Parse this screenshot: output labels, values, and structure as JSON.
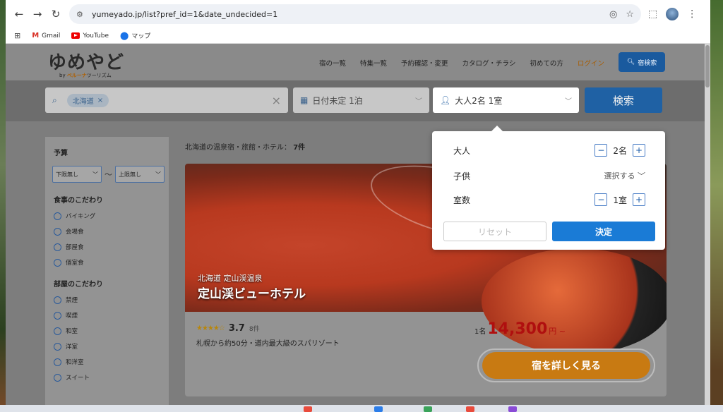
{
  "browser": {
    "url": "yumeyado.jp/list?pref_id=1&date_undecided=1",
    "bookmarks": [
      {
        "label": "Gmail"
      },
      {
        "label": "YouTube"
      },
      {
        "label": "マップ"
      }
    ]
  },
  "header": {
    "logo": "ゆめやど",
    "logo_sub_by": "by ",
    "logo_sub_brand": "ベルーナ",
    "logo_sub_rest": "ツーリズム",
    "nav": [
      "宿の一覧",
      "特集一覧",
      "予約確認・変更",
      "カタログ・チラシ",
      "初めての方",
      "ログイン"
    ],
    "search_button": "宿検索"
  },
  "search": {
    "area_chip": "北海道",
    "date_label": "日付未定 1泊",
    "guests_label": "大人2名 1室",
    "search_button": "検索"
  },
  "sidebar": {
    "budget_title": "予算",
    "budget_min": "下限無し",
    "budget_sep": "〜",
    "budget_max": "上限無し",
    "meal_title": "食事のこだわり",
    "meal_options": [
      "バイキング",
      "会場食",
      "部屋食",
      "個室食"
    ],
    "room_title": "部屋のこだわり",
    "room_options": [
      "禁煙",
      "喫煙",
      "和室",
      "洋室",
      "和洋室",
      "スイート"
    ]
  },
  "results": {
    "count_prefix": "北海道の温泉宿・旅館・ホテル：",
    "count": "7件"
  },
  "hotel": {
    "area": "北海道 定山渓温泉",
    "name": "定山渓ビューホテル",
    "stars": "★★★★☆",
    "rating_value": 3.7,
    "score": "3.7",
    "reviews": "8件",
    "description": "札幌から約50分・道内最大級のスパリゾート",
    "price_per": "1名",
    "price": "14,300",
    "price_unit": "円 ~",
    "detail_button": "宿を詳しく見る"
  },
  "guest_popup": {
    "adults_label": "大人",
    "adults_value": "2名",
    "children_label": "子供",
    "children_select": "選択する",
    "rooms_label": "室数",
    "rooms_value": "1室",
    "reset_button": "リセット",
    "ok_button": "決定"
  },
  "colors": {
    "brand_blue": "#1a7bd6",
    "price_red": "#b00f0f",
    "detail_orange": "#c87a12"
  }
}
